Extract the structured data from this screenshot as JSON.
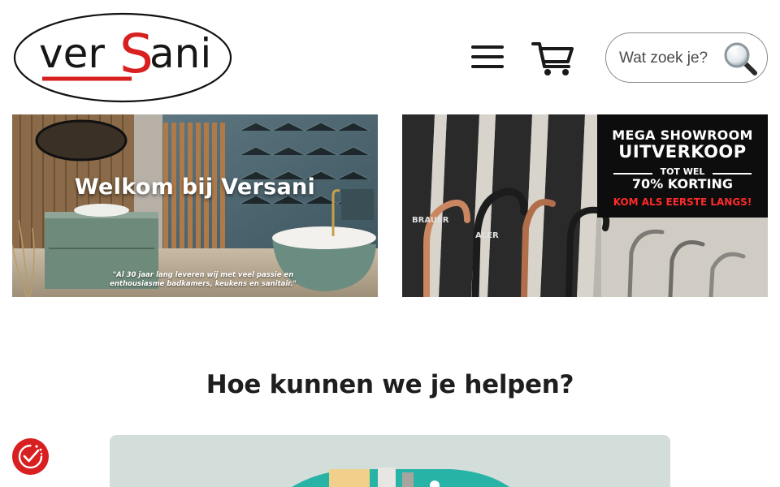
{
  "header": {
    "logo_text": "verSani",
    "search": {
      "placeholder": "Wat zoek je?"
    }
  },
  "banners": [
    {
      "title": "Welkom bij Versani",
      "quote": "\"Al 30 jaar lang leveren wij met veel passie en enthousiasme badkamers, keukens en sanitair.\""
    },
    {
      "brand_text_1": "BRAUER",
      "brand_text_2": "ALER",
      "promo": {
        "line1": "MEGA SHOWROOM",
        "line2": "UITVERKOOP",
        "line3": "TOT WEL",
        "line4": "70% KORTING",
        "line5": "KOM ALS EERSTE LANGS!"
      }
    }
  ],
  "help": {
    "title": "Hoe kunnen we je helpen?"
  },
  "colors": {
    "brand_red": "#d7201f",
    "promo_red": "#ff2a2a",
    "card_bg": "#d3ddda",
    "text_dark": "#1e1e1e"
  },
  "icons": [
    "hamburger-menu-icon",
    "shopping-cart-icon",
    "magnifier-icon",
    "cookie-settings-icon"
  ]
}
